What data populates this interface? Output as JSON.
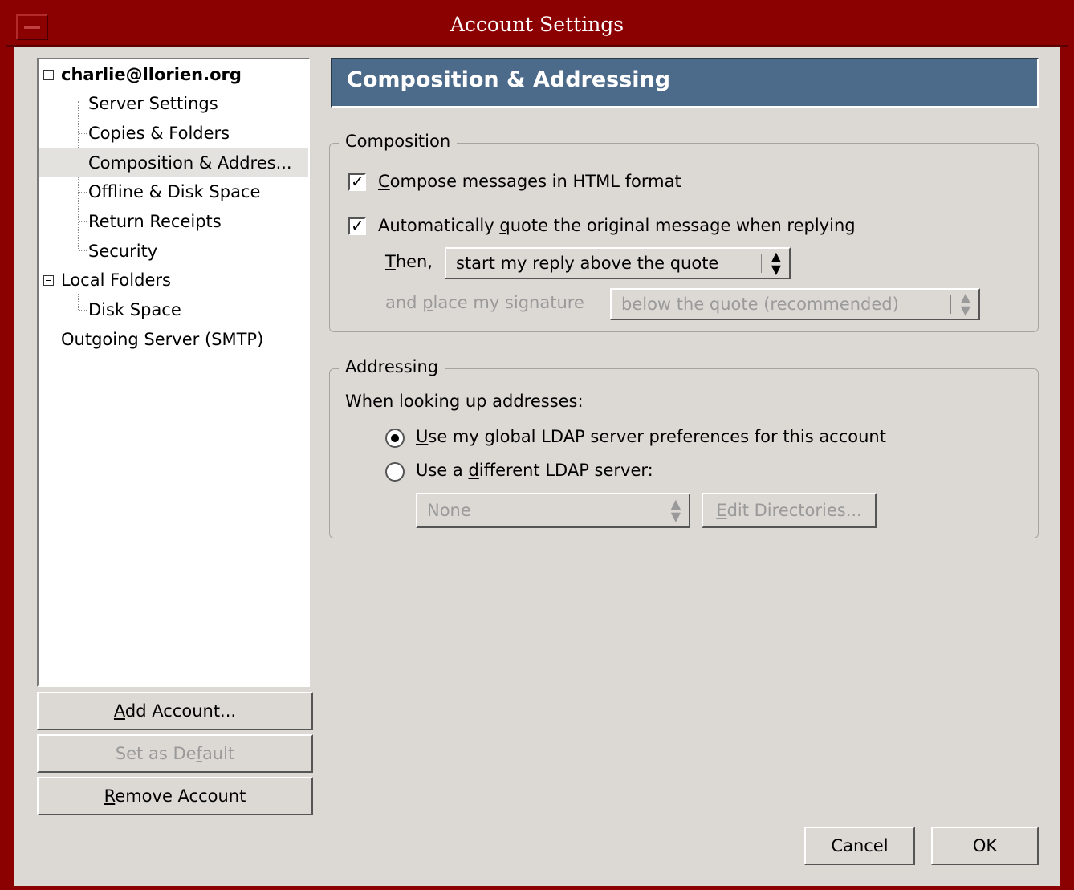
{
  "window": {
    "title": "Account Settings"
  },
  "tree": {
    "items": [
      {
        "label": "charlie@llorien.org",
        "level": 0,
        "expanded": true,
        "bold": true
      },
      {
        "label": "Server Settings",
        "level": 1
      },
      {
        "label": "Copies & Folders",
        "level": 1
      },
      {
        "label": "Composition & Addres...",
        "level": 1,
        "selected": true
      },
      {
        "label": "Offline & Disk Space",
        "level": 1
      },
      {
        "label": "Return Receipts",
        "level": 1
      },
      {
        "label": "Security",
        "level": 1
      },
      {
        "label": "Local Folders",
        "level": 0,
        "expanded": true
      },
      {
        "label": "Disk Space",
        "level": 1
      },
      {
        "label": "Outgoing Server (SMTP)",
        "level": 0
      }
    ]
  },
  "buttons": {
    "add_account": {
      "pre": "",
      "key": "A",
      "post": "dd Account..."
    },
    "set_default": {
      "pre": "Set as De",
      "key": "f",
      "post": "ault"
    },
    "remove_account": {
      "pre": "",
      "key": "R",
      "post": "emove Account"
    },
    "cancel": "Cancel",
    "ok": "OK"
  },
  "panel": {
    "header": "Composition & Addressing",
    "composition": {
      "legend": "Composition",
      "html_format": {
        "pre": "",
        "key": "C",
        "post": "ompose messages in HTML format",
        "checked": true
      },
      "auto_quote": {
        "pre": "Automatically ",
        "key": "q",
        "post": "uote the original message when replying",
        "checked": true
      },
      "then_label": {
        "pre": "",
        "key": "T",
        "post": "hen,"
      },
      "then_select": "start my reply above the quote",
      "signature_label": {
        "pre": "and ",
        "key": "p",
        "post": "lace my signature"
      },
      "signature_select": "below the quote (recommended)"
    },
    "addressing": {
      "legend": "Addressing",
      "lookup_label": "When looking up addresses:",
      "use_global": {
        "pre": "",
        "key": "U",
        "post": "se my global LDAP server preferences for this account",
        "selected": true
      },
      "use_different": {
        "pre": "Use a ",
        "key": "d",
        "post": "ifferent LDAP server:",
        "selected": false
      },
      "ldap_select": "None",
      "edit_directories": {
        "pre": "",
        "key": "E",
        "post": "dit Directories..."
      }
    }
  }
}
